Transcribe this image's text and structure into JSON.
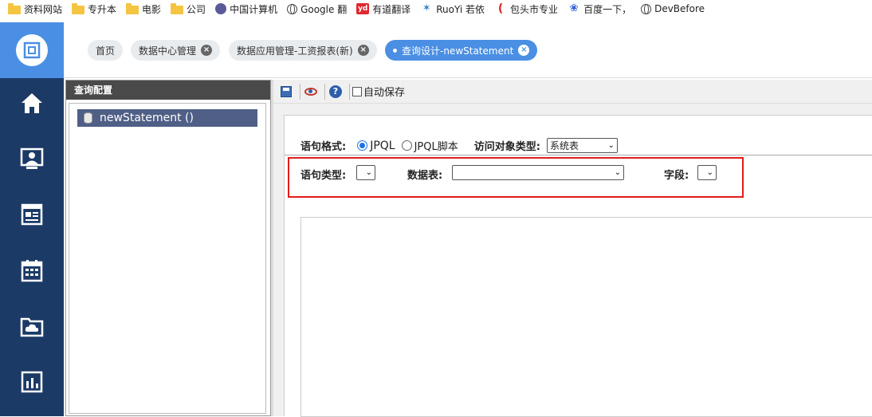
{
  "bookmarks": [
    {
      "label": "资料网站",
      "icon": "folder-icon"
    },
    {
      "label": "专升本",
      "icon": "folder-icon"
    },
    {
      "label": "电影",
      "icon": "folder-icon"
    },
    {
      "label": "公司",
      "icon": "folder-icon"
    },
    {
      "label": "中国计算机",
      "icon": "site-icon"
    },
    {
      "label": "Google 翻",
      "icon": "globe-icon"
    },
    {
      "label": "有道翻译",
      "icon": "youdao-icon"
    },
    {
      "label": "RuoYi 若依",
      "icon": "ruoyi-icon"
    },
    {
      "label": "包头市专业",
      "icon": "baotou-icon"
    },
    {
      "label": "百度一下，",
      "icon": "baidu-icon"
    },
    {
      "label": "DevBefore",
      "icon": "globe-icon"
    }
  ],
  "tabs": [
    {
      "label": "首页",
      "closable": false
    },
    {
      "label": "数据中心管理",
      "closable": true
    },
    {
      "label": "数据应用管理-工资报表(新)",
      "closable": true
    },
    {
      "label": "查询设计-newStatement",
      "closable": true,
      "active": true
    }
  ],
  "left_panel": {
    "title": "查询配置",
    "tree_item": "newStatement ()"
  },
  "toolbar": {
    "autosave_label": "自动保存"
  },
  "form": {
    "format_label": "语句格式:",
    "radio_jpql": "JPQL",
    "radio_jpql_script": "JPQL脚本",
    "object_type_label": "访问对象类型:",
    "object_type_value": "系统表",
    "statement_type_label": "语句类型:",
    "statement_type_value": "",
    "table_label": "数据表:",
    "table_value": "",
    "field_label": "字段:",
    "field_value": ""
  },
  "colors": {
    "sidebar": "#1c3a66",
    "accent": "#4a8fe4",
    "highlight_box": "#e41b1b"
  }
}
